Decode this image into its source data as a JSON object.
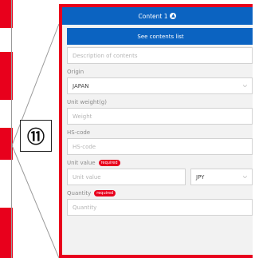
{
  "panel": {
    "title": "Content 1",
    "list_button": "See contents list",
    "description_placeholder": "Description of contents",
    "origin_label": "Origin",
    "origin_value": "JAPAN",
    "unit_weight_label": "Unit weight(g)",
    "weight_placeholder": "Weight",
    "hs_code_label": "HS-code",
    "hs_code_placeholder": "HS-code",
    "unit_value_label": "Unit value",
    "unit_value_placeholder": "Unit value",
    "currency_value": "JPY",
    "quantity_label": "Quantity",
    "quantity_placeholder": "Quantity",
    "required_badge": "required"
  },
  "step_marker": "⑪",
  "icons": {
    "header": "collapse-circle-icon",
    "dropdown": "chevron-down-icon"
  },
  "colors": {
    "accent_blue": "#0b63c1",
    "highlight_red": "#e8001c"
  }
}
